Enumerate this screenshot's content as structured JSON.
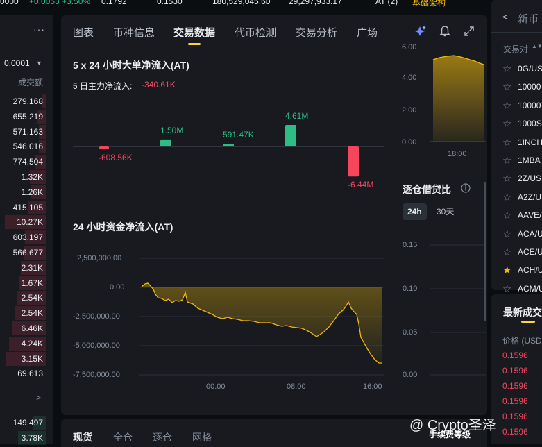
{
  "ticker": [
    "0000",
    "+0.0053 +3.50%",
    "0.1792",
    "0.1530",
    "180,529,045.60",
    "29,297,933.17",
    "AT (2)",
    "基础架构"
  ],
  "orderbook": {
    "step": "0.0001",
    "header": "成交额",
    "rows": [
      {
        "value": "279.168",
        "bar": 0.08
      },
      {
        "value": "655.219",
        "bar": 0.18
      },
      {
        "value": "571.163",
        "bar": 0.15
      },
      {
        "value": "546.016",
        "bar": 0.15
      },
      {
        "value": "774.504",
        "bar": 0.22
      },
      {
        "value": "1.32K",
        "bar": 0.35
      },
      {
        "value": "1.26K",
        "bar": 0.34
      },
      {
        "value": "415.105",
        "bar": 0.4
      },
      {
        "value": "10.27K",
        "bar": 0.9
      },
      {
        "value": "603.197",
        "bar": 0.45
      },
      {
        "value": "566.677",
        "bar": 0.48
      },
      {
        "value": "2.31K",
        "bar": 0.55
      },
      {
        "value": "1.67K",
        "bar": 0.58
      },
      {
        "value": "2.54K",
        "bar": 0.62
      },
      {
        "value": "2.54K",
        "bar": 0.66
      },
      {
        "value": "6.46K",
        "bar": 0.72
      },
      {
        "value": "4.24K",
        "bar": 0.8
      },
      {
        "value": "3.15K",
        "bar": 0.86
      },
      {
        "value": "69.613",
        "bar": 0.0
      }
    ],
    "bottom_rows": [
      {
        "value": "149.497"
      },
      {
        "value": "3.78K"
      }
    ]
  },
  "tabs": [
    {
      "label": "图表",
      "active": false
    },
    {
      "label": "币种信息",
      "active": false
    },
    {
      "label": "交易数据",
      "active": true
    },
    {
      "label": "代币检测",
      "active": false
    },
    {
      "label": "交易分析",
      "active": false
    },
    {
      "label": "广场",
      "active": false
    }
  ],
  "large_flow": {
    "title": "5 x 24 小时大单净流入(AT)",
    "subtitle_label": "5 日主力净流入:",
    "subtitle_value": "-340.61K",
    "bars": [
      {
        "label": "-608.56K",
        "value": -608.56
      },
      {
        "label": "1.50M",
        "value": 1500
      },
      {
        "label": "591.47K",
        "value": 591.47
      },
      {
        "label": "4.61M",
        "value": 4610
      },
      {
        "label": "-6.44M",
        "value": -6440
      }
    ]
  },
  "net_flow": {
    "title": "24 小时资金净流入(AT)",
    "y_ticks": [
      "2,500,000.00",
      "0.00",
      "-2,500,000.00",
      "-5,000,000.00",
      "-7,500,000.00"
    ],
    "x_ticks": [
      "00:00",
      "08:00",
      "16:00"
    ]
  },
  "mini_chart": {
    "y_ticks": [
      "6.00",
      "4.00",
      "2.00",
      "0.00"
    ],
    "x_tick": "18:00"
  },
  "lending": {
    "title": "逐仓借贷比",
    "toggle_on": "24h",
    "toggle_off": "30天",
    "y_ticks": [
      "0.15",
      "0.10",
      "0.05",
      "0.00"
    ]
  },
  "trade_tabs": [
    "现货",
    "全仓",
    "逐仓",
    "网格"
  ],
  "right_panel": {
    "back_label": "新币",
    "col_header": "交易对",
    "pairs": [
      {
        "name": "0G/US",
        "fav": false
      },
      {
        "name": "10000",
        "fav": false
      },
      {
        "name": "10000",
        "fav": false
      },
      {
        "name": "1000S",
        "fav": false
      },
      {
        "name": "1INCH",
        "fav": false
      },
      {
        "name": "1MBA",
        "fav": false
      },
      {
        "name": "2Z/US",
        "fav": false
      },
      {
        "name": "A2Z/U",
        "fav": false
      },
      {
        "name": "AAVE/",
        "fav": false
      },
      {
        "name": "ACA/U",
        "fav": false
      },
      {
        "name": "ACE/U",
        "fav": false
      },
      {
        "name": "ACH/U",
        "fav": true
      },
      {
        "name": "ACM/U",
        "fav": false
      }
    ],
    "recent_title": "最新成交",
    "price_header": "价格 (USD",
    "prices": [
      "0.1596",
      "0.1596",
      "0.1596",
      "0.1596",
      "0.1596",
      "0.1596"
    ]
  },
  "watermark": {
    "text": "@ Crypto圣泽",
    "sub": "手续费等级"
  },
  "colors": {
    "up": "#2ebd85",
    "down": "#f6465d",
    "accent": "#fcd535",
    "area": "#f0b90b"
  }
}
